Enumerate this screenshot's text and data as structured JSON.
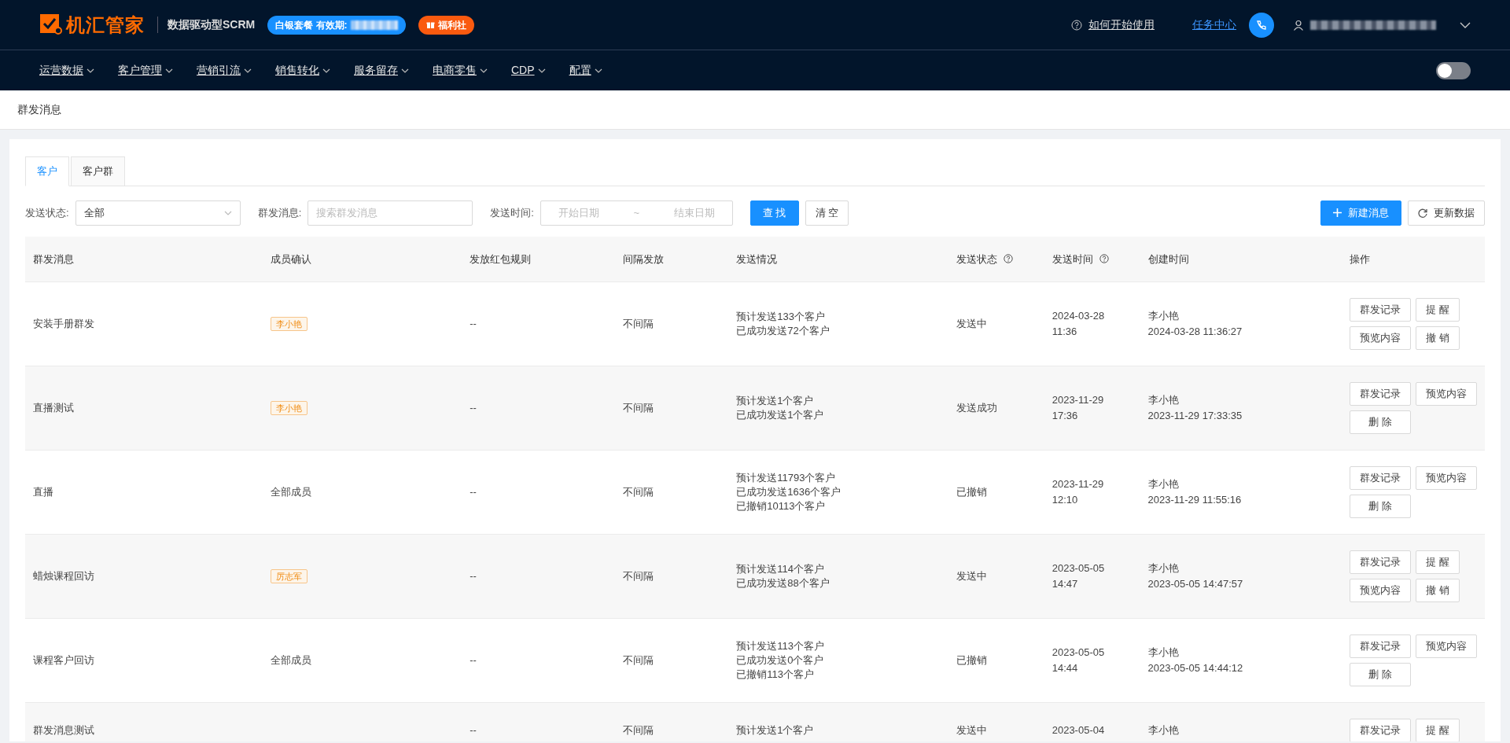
{
  "header": {
    "logo": "机汇管家",
    "tagline": "数据驱动型SCRM",
    "plan_badge": "白银套餐 有效期:",
    "welfare_badge": "福利社",
    "help_link": "如何开始使用",
    "task_center": "任务中心"
  },
  "nav": {
    "items": [
      "运营数据",
      "客户管理",
      "营销引流",
      "销售转化",
      "服务留存",
      "电商零售",
      "CDP",
      "配置"
    ],
    "toggle": {
      "on": false
    }
  },
  "breadcrumb": "群发消息",
  "tabs": [
    {
      "label": "客户",
      "selected": true
    },
    {
      "label": "客户群",
      "selected": false
    }
  ],
  "filters": [
    {
      "kind": "select",
      "label": "发送状态:",
      "value": "全部"
    },
    {
      "kind": "text",
      "label": "群发消息:",
      "placeholder": "搜索群发消息"
    },
    {
      "kind": "daterange",
      "label": "发送时间:",
      "start_placeholder": "开始日期",
      "separator": "~",
      "end_placeholder": "结束日期"
    }
  ],
  "filter_buttons": [
    {
      "kind": "primary",
      "label": "查 找"
    },
    {
      "kind": "default",
      "label": "清 空"
    }
  ],
  "toolbar_buttons": [
    {
      "kind": "primary",
      "label": "新建消息"
    },
    {
      "kind": "default",
      "label": "更新数据"
    }
  ],
  "table": {
    "columns": [
      {
        "label": "群发消息",
        "help": false
      },
      {
        "label": "成员确认",
        "help": false
      },
      {
        "label": "发放红包规则",
        "help": false
      },
      {
        "label": "间隔发放",
        "help": false
      },
      {
        "label": "发送情况",
        "help": false
      },
      {
        "label": "发送状态",
        "help": true
      },
      {
        "label": "发送时间",
        "help": true
      },
      {
        "label": "创建时间",
        "help": false
      },
      {
        "label": "操作",
        "help": false
      }
    ],
    "rows": [
      {
        "name": "安装手册群发",
        "member": {
          "kind": "tag",
          "text": "李小艳"
        },
        "red_packet": "--",
        "interval": "不间隔",
        "send_info": [
          "预计发送133个客户",
          "已成功发送72个客户"
        ],
        "status": "发送中",
        "send_time": [
          "2024-03-28",
          "11:36"
        ],
        "creator": {
          "name": "李小艳",
          "time": "2024-03-28 11:36:27"
        },
        "actions": [
          "群发记录",
          "提 醒",
          "预览内容",
          "撤 销"
        ]
      },
      {
        "name": "直播测试",
        "member": {
          "kind": "tag",
          "text": "李小艳"
        },
        "red_packet": "--",
        "interval": "不间隔",
        "send_info": [
          "预计发送1个客户",
          "已成功发送1个客户"
        ],
        "status": "发送成功",
        "send_time": [
          "2023-11-29",
          "17:36"
        ],
        "creator": {
          "name": "李小艳",
          "time": "2023-11-29 17:33:35"
        },
        "actions": [
          "群发记录",
          "预览内容",
          "删 除"
        ]
      },
      {
        "name": "直播",
        "member": {
          "kind": "plain",
          "text": "全部成员"
        },
        "red_packet": "--",
        "interval": "不间隔",
        "send_info": [
          "预计发送11793个客户",
          "已成功发送1636个客户",
          "已撤销10113个客户"
        ],
        "status": "已撤销",
        "send_time": [
          "2023-11-29",
          "12:10"
        ],
        "creator": {
          "name": "李小艳",
          "time": "2023-11-29 11:55:16"
        },
        "actions": [
          "群发记录",
          "预览内容",
          "删 除"
        ]
      },
      {
        "name": "蜡烛课程回访",
        "member": {
          "kind": "tag",
          "text": "厉志军"
        },
        "red_packet": "--",
        "interval": "不间隔",
        "send_info": [
          "预计发送114个客户",
          "已成功发送88个客户"
        ],
        "status": "发送中",
        "send_time": [
          "2023-05-05",
          "14:47"
        ],
        "creator": {
          "name": "李小艳",
          "time": "2023-05-05 14:47:57"
        },
        "actions": [
          "群发记录",
          "提 醒",
          "预览内容",
          "撤 销"
        ]
      },
      {
        "name": "课程客户回访",
        "member": {
          "kind": "plain",
          "text": "全部成员"
        },
        "red_packet": "--",
        "interval": "不间隔",
        "send_info": [
          "预计发送113个客户",
          "已成功发送0个客户",
          "已撤销113个客户"
        ],
        "status": "已撤销",
        "send_time": [
          "2023-05-05",
          "14:44"
        ],
        "creator": {
          "name": "李小艳",
          "time": "2023-05-05 14:44:12"
        },
        "actions": [
          "群发记录",
          "预览内容",
          "删 除"
        ]
      },
      {
        "name": "群发消息测试",
        "red_packet": "--",
        "interval": "不间隔",
        "send_info": [
          "预计发送1个客户"
        ],
        "status": "发送中",
        "send_time": [
          "2023-05-04"
        ],
        "creator": {
          "name": "李小艳"
        },
        "actions": [
          "群发记录",
          "提 醒"
        ]
      }
    ]
  }
}
